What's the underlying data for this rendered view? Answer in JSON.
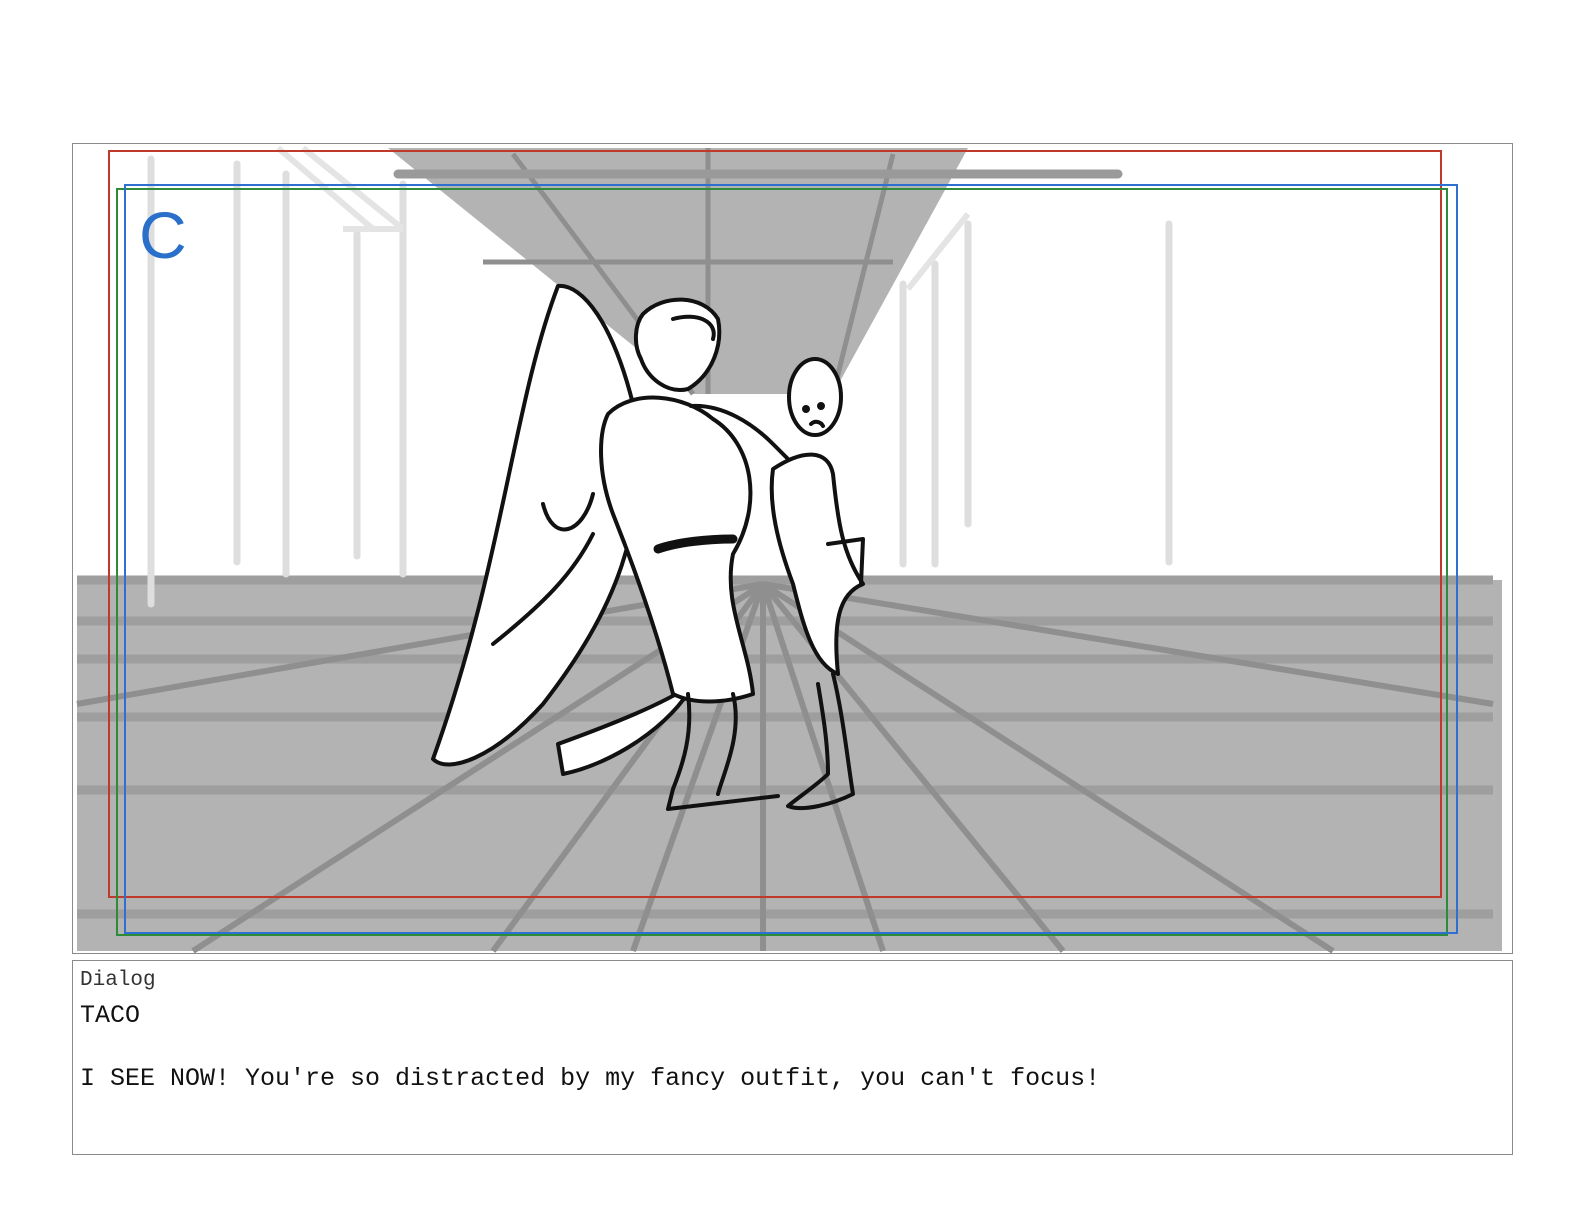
{
  "panel": {
    "label": "C",
    "frame_colors": {
      "safe_area": "#c0392b",
      "action_safe": "#2f6fd0",
      "title_safe": "#2e8b3a"
    }
  },
  "dialog": {
    "label": "Dialog",
    "character": "TACO",
    "line": "I SEE NOW! You're so distracted by my fancy outfit, you can't focus!"
  }
}
